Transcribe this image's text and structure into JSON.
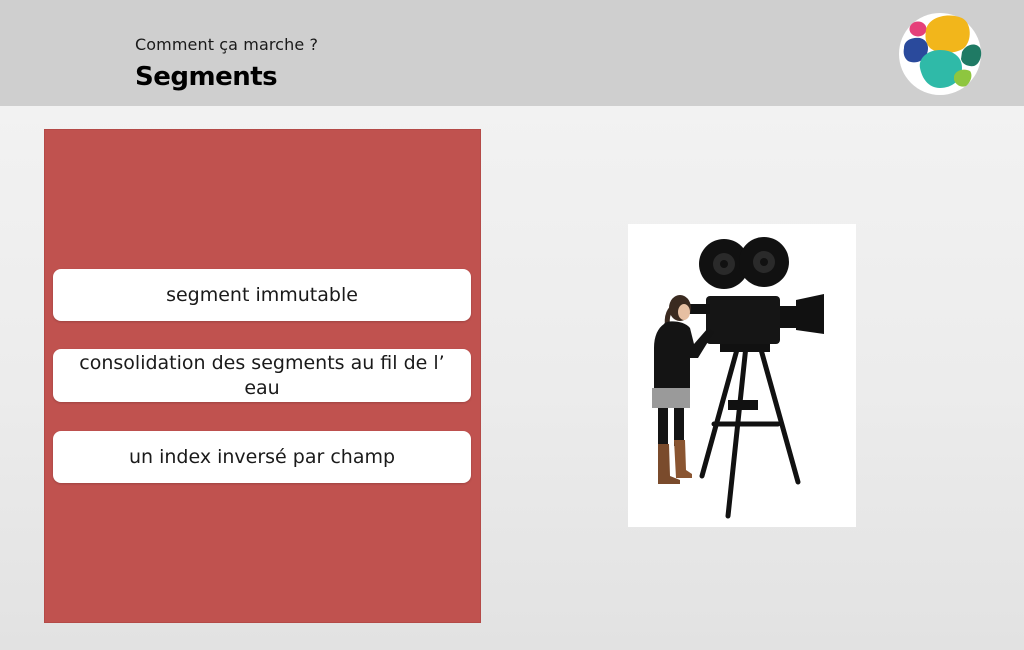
{
  "header": {
    "subtitle": "Comment ça marche ?",
    "title": "Segments",
    "logo_icon": "elastic-logo-icon",
    "background_color": "#cfcfcf"
  },
  "panel": {
    "background_color": "#c0524f",
    "items": [
      {
        "label": "segment immutable"
      },
      {
        "label": "consolidation des segments au fil de l’ eau"
      },
      {
        "label": "un index inversé par champ"
      }
    ]
  },
  "illustration": {
    "icon": "film-camera-woman-icon"
  },
  "colors": {
    "logo_yellow": "#f2b61b",
    "logo_teal": "#2fbaa8",
    "logo_blue": "#2a4a9c",
    "logo_pink": "#e5407a",
    "logo_green": "#8ec63f",
    "logo_darkgreen": "#1f7a64"
  }
}
